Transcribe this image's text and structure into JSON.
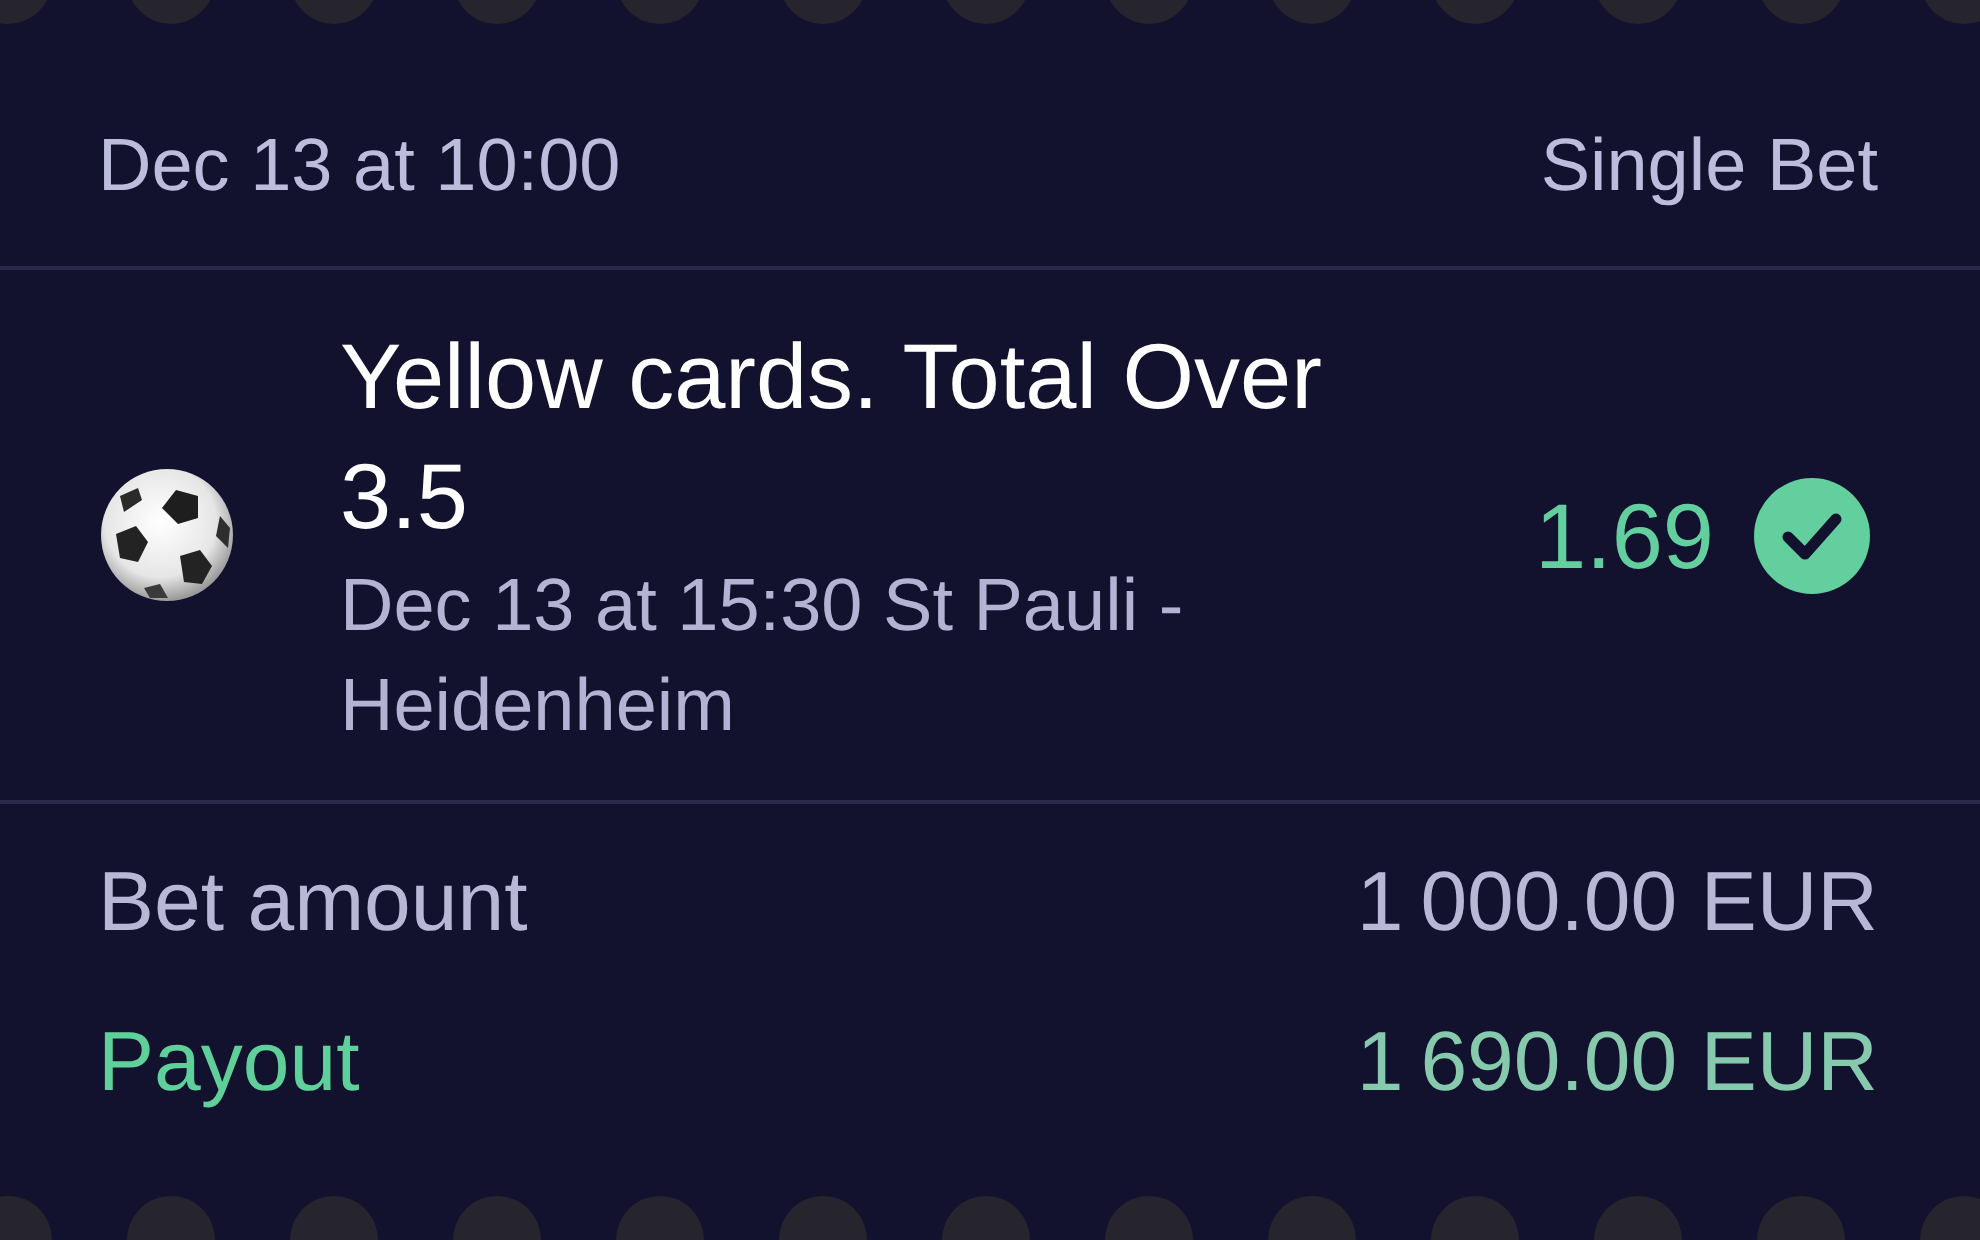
{
  "header": {
    "date": "Dec 13 at 10:00",
    "bet_type": "Single Bet"
  },
  "bet": {
    "title": "Yellow cards. Total Over 3.5",
    "event": "Dec 13 at 15:30 St Pauli - Heidenheim",
    "odds": "1.69",
    "won": true
  },
  "summary": {
    "stake": {
      "label": "Bet amount",
      "value": "1 000.00 EUR"
    },
    "payout": {
      "label": "Payout",
      "value": "1 690.00 EUR"
    }
  }
}
